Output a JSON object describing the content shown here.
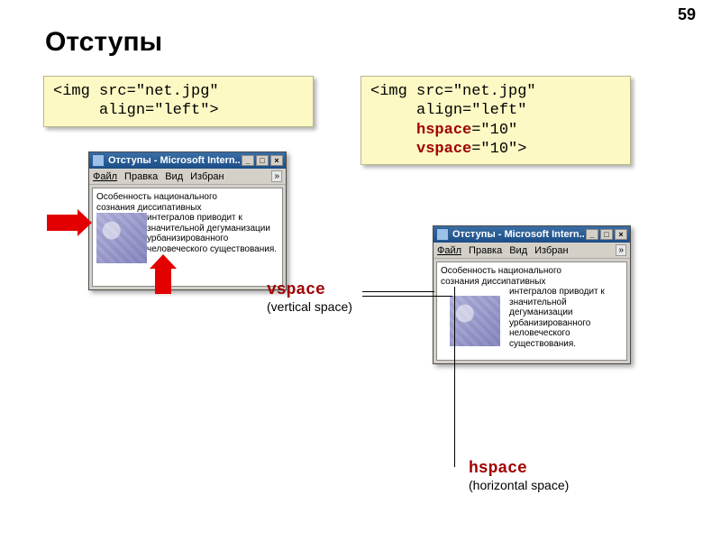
{
  "pageNumber": "59",
  "title": "Отступы",
  "codeLeft": {
    "l1": "<img src=\"net.jpg\"",
    "l2": "     align=\"left\">"
  },
  "codeRight": {
    "l1": "<img src=\"net.jpg\"",
    "l2": "     align=\"left\"",
    "l3a": "     ",
    "l3kw": "hspace",
    "l3b": "=\"10\"",
    "l4a": "     ",
    "l4kw": "vspace",
    "l4b": "=\"10\">"
  },
  "win": {
    "titleText": "Отступы - Microsoft Intern...",
    "min": "_",
    "max": "□",
    "close": "×",
    "menu": {
      "file": "Файл",
      "edit": "Правка",
      "view": "Вид",
      "fav": "Избран",
      "chev": "»"
    },
    "sample": {
      "line1": "Особенность национального",
      "line2": "сознания диссипативных",
      "rest": "интегралов приводит к значительной дегуманизации урбанизированного человеческого существования."
    },
    "sample2": {
      "rest": "интегралов приводит к значительной дегуманизации урбанизированного неловеческого существования."
    }
  },
  "labels": {
    "vspace": "vspace",
    "vspaceSub": "(vertical space)",
    "hspace": "hspace",
    "hspaceSub": "(horizontal space)"
  }
}
